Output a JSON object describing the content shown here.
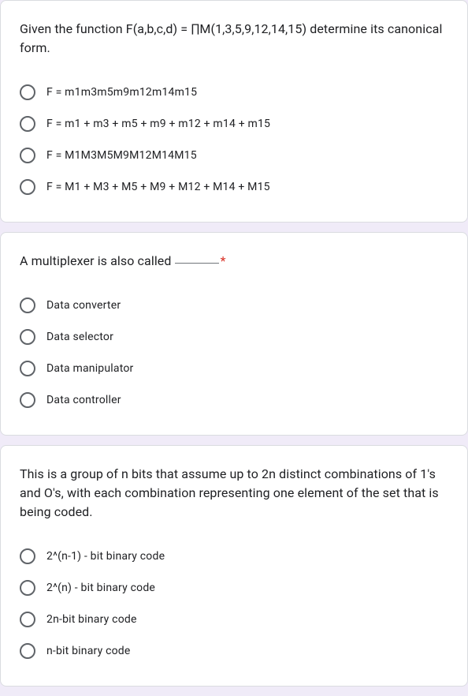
{
  "questions": [
    {
      "prompt": "Given the function F(a,b,c,d)  =  ∏M(1,3,5,9,12,14,15) determine its canonical form.",
      "required": false,
      "blank": false,
      "options": [
        "F = m1m3m5m9m12m14m15",
        "F = m1 + m3 + m5 + m9 + m12 + m14 + m15",
        "F = M1M3M5M9M12M14M15",
        "F = M1 + M3 + M5 + M9 + M12 + M14 + M15"
      ]
    },
    {
      "prompt": "A multiplexer is also called ",
      "required": true,
      "blank": true,
      "options": [
        "Data converter",
        "Data selector",
        "Data manipulator",
        "Data controller"
      ]
    },
    {
      "prompt": "This is a group of n bits that assume up to 2n distinct combinations of 1's and O's, with each combination representing one element of the set that is being coded.",
      "required": false,
      "blank": false,
      "options": [
        "2^(n-1) - bit binary code",
        "2^(n) - bit binary code",
        "2n-bit binary code",
        "n-bit binary code"
      ]
    }
  ]
}
